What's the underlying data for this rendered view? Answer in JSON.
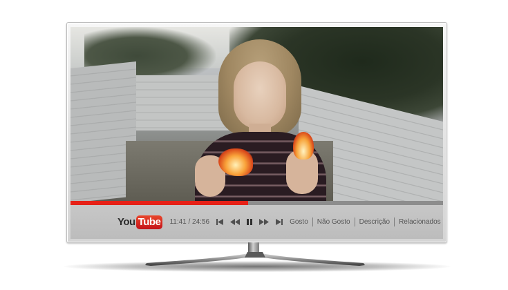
{
  "player": {
    "logo": {
      "you": "You",
      "tube": "Tube"
    },
    "time": "11:41 / 24:56",
    "progress": {
      "played_fraction": 0.476,
      "accent_color": "#e62117"
    },
    "controls": {
      "skip_back_icon": "skip-previous-icon",
      "rewind_icon": "rewind-icon",
      "pause_icon": "pause-icon",
      "fast_forward_icon": "fast-forward-icon",
      "skip_next_icon": "skip-next-icon"
    },
    "links": [
      "Gosto",
      "Não Gosto",
      "Descrição",
      "Relacionados"
    ]
  }
}
